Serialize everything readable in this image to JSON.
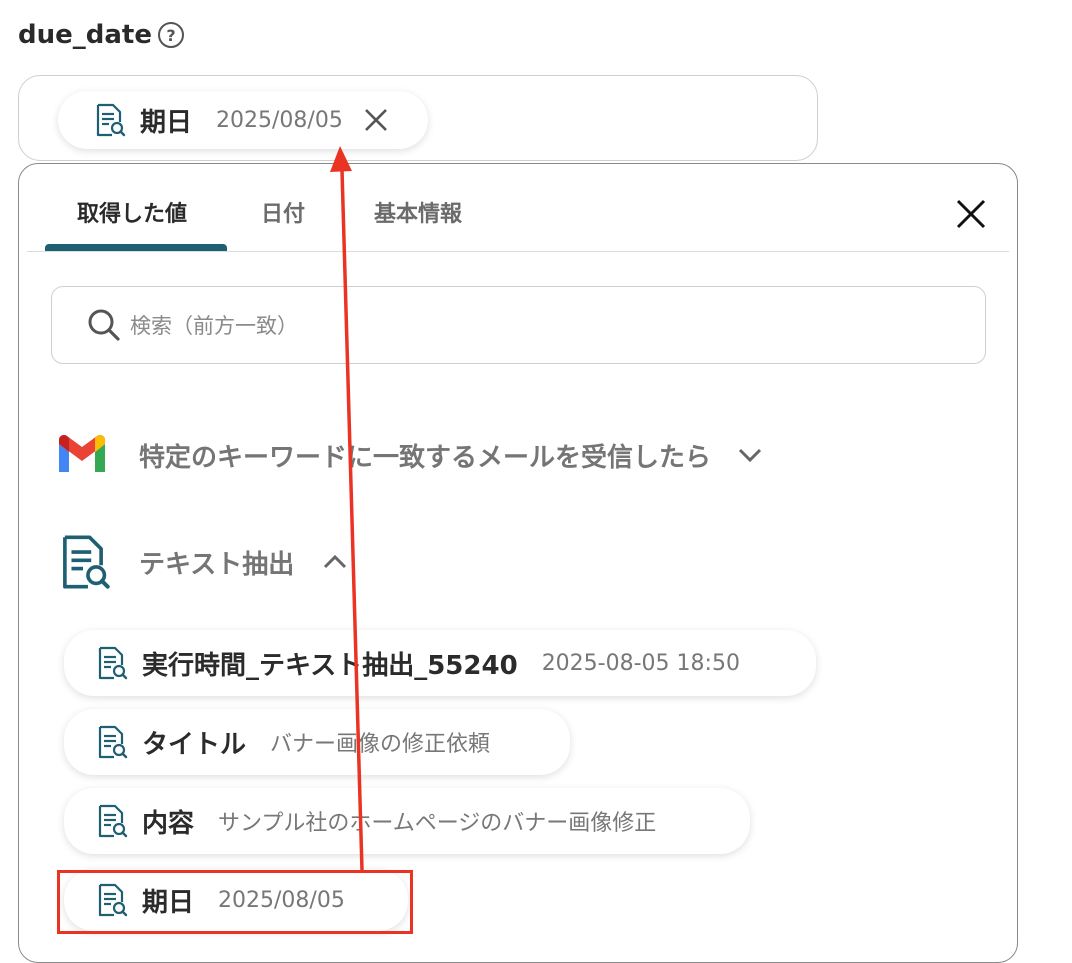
{
  "field": {
    "label": "due_date",
    "help_glyph": "?",
    "chip": {
      "key": "期日",
      "value": "2025/08/05",
      "remove_glyph": "✕"
    }
  },
  "panel": {
    "tabs": [
      {
        "label": "取得した値",
        "active": true
      },
      {
        "label": "日付",
        "active": false
      },
      {
        "label": "基本情報",
        "active": false
      }
    ],
    "search": {
      "placeholder": "検索（前方一致）"
    },
    "sections": [
      {
        "title": "特定のキーワードに一致するメールを受信したら",
        "icon": "gmail-icon",
        "expanded": false
      },
      {
        "title": "テキスト抽出",
        "icon": "document-search-icon",
        "expanded": true
      }
    ],
    "items": [
      {
        "key": "実行時間_テキスト抽出_55240",
        "value": "2025-08-05 18:50"
      },
      {
        "key": "タイトル",
        "value": "バナー画像の修正依頼"
      },
      {
        "key": "内容",
        "value": "サンプル社のホームページのバナー画像修正"
      },
      {
        "key": "期日",
        "value": "2025/08/05",
        "highlighted": true
      }
    ]
  },
  "colors": {
    "accent": "#1f5f73",
    "annotation_red": "#ea3323"
  }
}
